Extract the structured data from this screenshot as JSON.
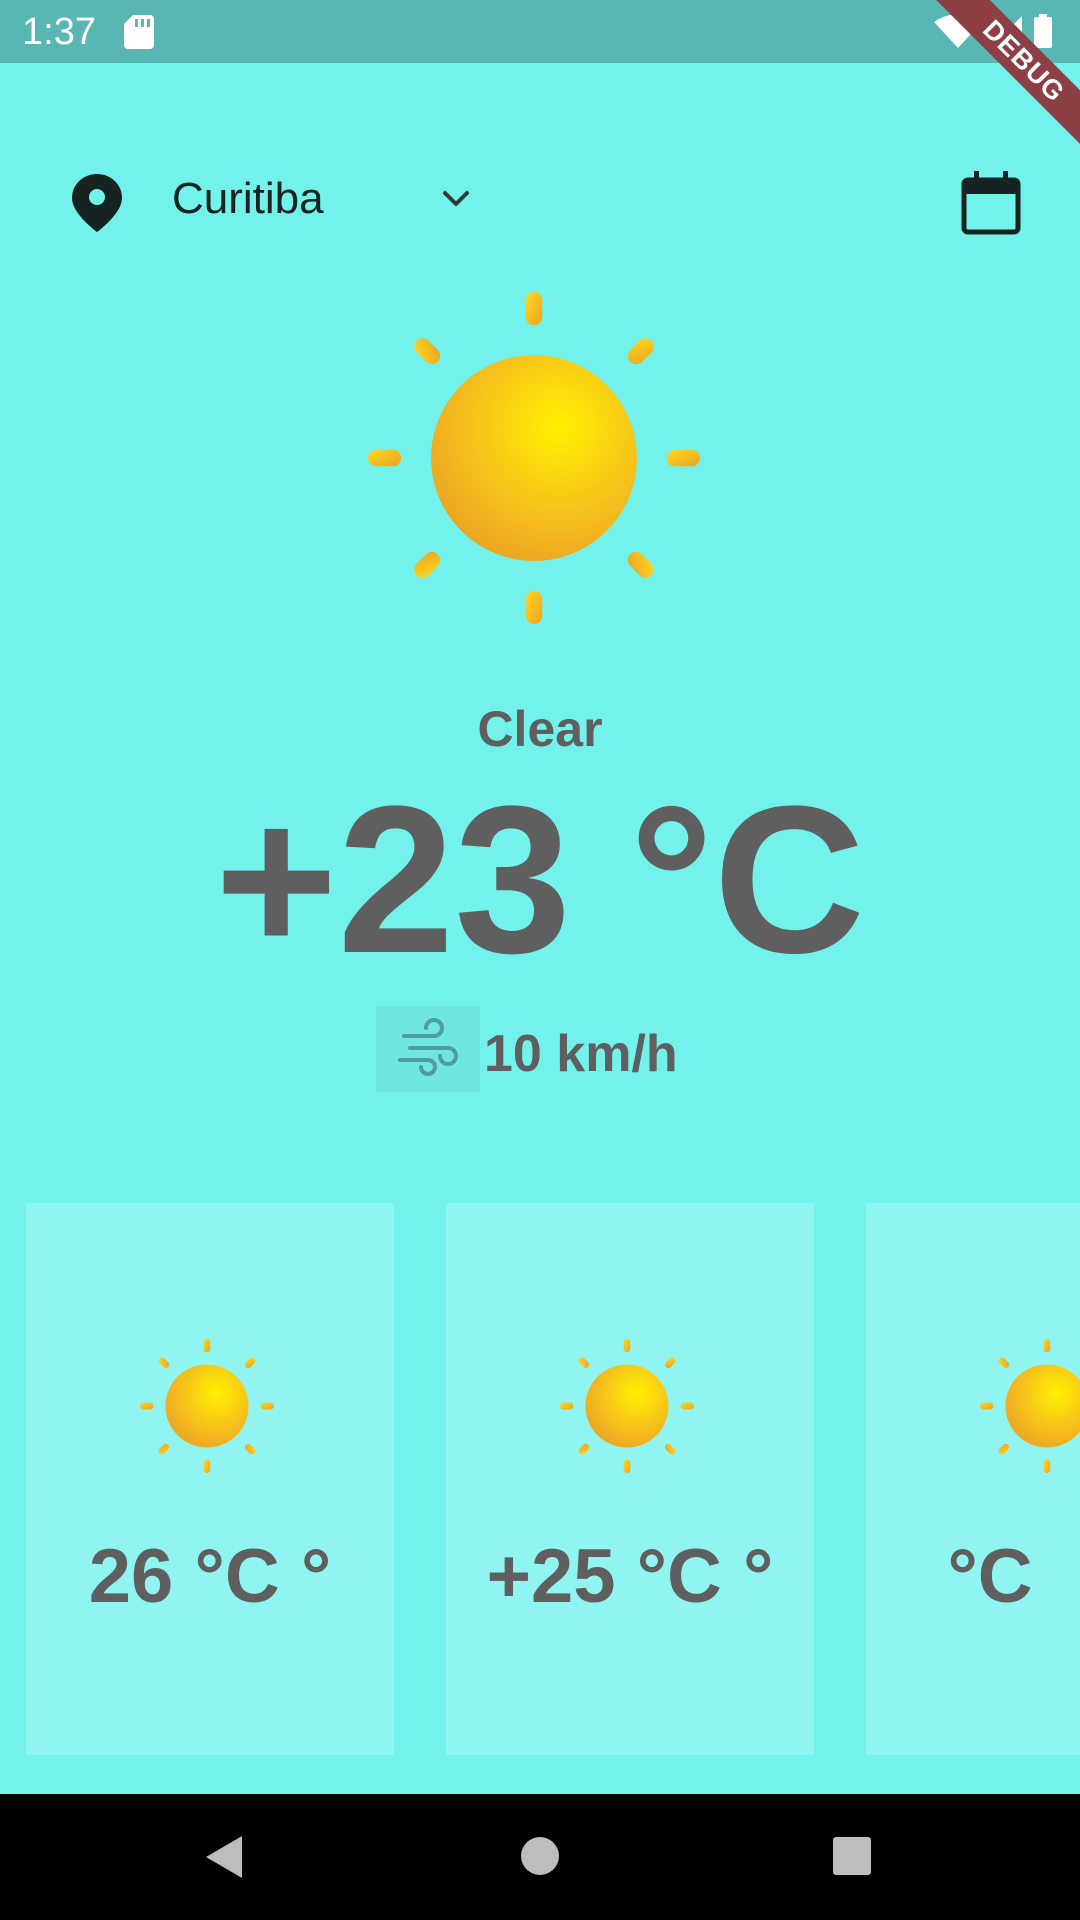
{
  "status_bar": {
    "time": "1:37",
    "icons": [
      "sd-card-icon",
      "wifi-icon",
      "cell-signal-icon",
      "battery-icon"
    ],
    "background": "#58B7B2"
  },
  "debug_banner": {
    "label": "DEBUG",
    "color": "#8D3F45"
  },
  "header": {
    "location_icon": "location-pin-icon",
    "city": "Curitiba",
    "dropdown_icon": "chevron-down-icon",
    "calendar_icon": "calendar-icon"
  },
  "current": {
    "icon": "sun-icon",
    "condition": "Clear",
    "temperature": "+23 °C",
    "wind_icon": "wind-icon",
    "wind_speed": "10 km/h"
  },
  "forecast": [
    {
      "icon": "sun-icon",
      "temperature": "26 °C °"
    },
    {
      "icon": "sun-icon",
      "temperature": "+25 °C °"
    },
    {
      "icon": "sun-icon",
      "temperature": "°C"
    }
  ],
  "nav_bar": {
    "icons": [
      "back-icon",
      "home-icon",
      "recents-icon"
    ]
  },
  "colors": {
    "background": "#72F2EA",
    "card": "#90F4F1",
    "text": "#5F5F5F",
    "sun_yellow": "#F7C21B"
  }
}
